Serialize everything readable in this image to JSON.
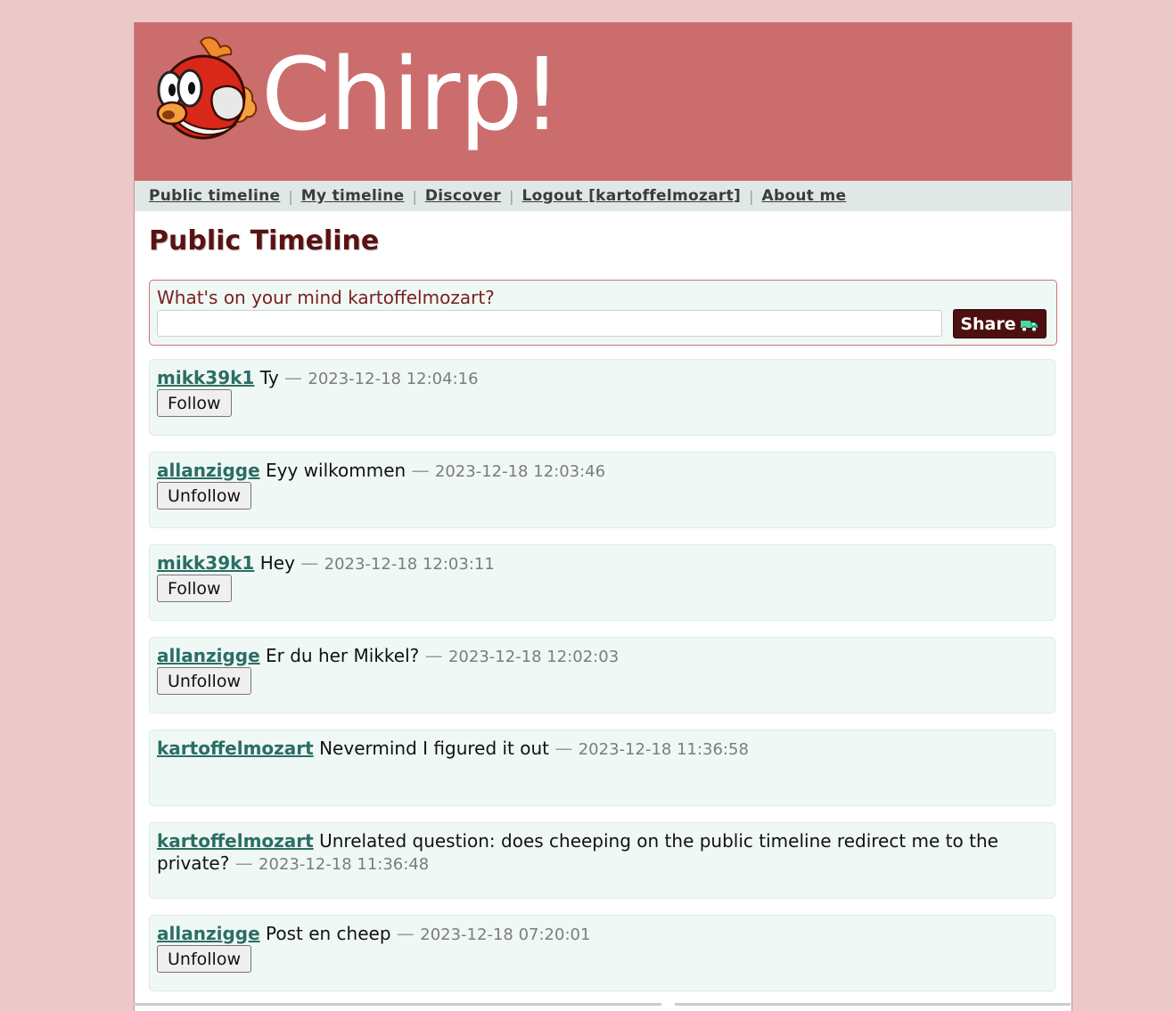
{
  "header": {
    "brand": "Chirp!"
  },
  "nav": {
    "public_timeline": "Public timeline",
    "my_timeline": "My timeline",
    "discover": "Discover",
    "logout": "Logout [kartoffelmozart]",
    "about_me": "About me",
    "separator": "|"
  },
  "page_title": "Public Timeline",
  "composer": {
    "label": "What's on your mind kartoffelmozart?",
    "value": "",
    "share_label": "Share"
  },
  "cheeps": [
    {
      "author": "mikk39k1",
      "text": "Ty",
      "dash": "—",
      "timestamp": "2023-12-18 12:04:16",
      "button": "Follow"
    },
    {
      "author": "allanzigge",
      "text": "Eyy wilkommen",
      "dash": "—",
      "timestamp": "2023-12-18 12:03:46",
      "button": "Unfollow"
    },
    {
      "author": "mikk39k1",
      "text": "Hey",
      "dash": "—",
      "timestamp": "2023-12-18 12:03:11",
      "button": "Follow"
    },
    {
      "author": "allanzigge",
      "text": "Er du her Mikkel?",
      "dash": "—",
      "timestamp": "2023-12-18 12:02:03",
      "button": "Unfollow"
    },
    {
      "author": "kartoffelmozart",
      "text": "Nevermind I figured it out",
      "dash": "—",
      "timestamp": "2023-12-18 11:36:58",
      "button": ""
    },
    {
      "author": "kartoffelmozart",
      "text": "Unrelated question: does cheeping on the public timeline redirect me to the private?",
      "dash": "—",
      "timestamp": "2023-12-18 11:36:48",
      "button": ""
    },
    {
      "author": "allanzigge",
      "text": "Post en cheep",
      "dash": "—",
      "timestamp": "2023-12-18 07:20:01",
      "button": "Unfollow"
    }
  ],
  "colors": {
    "background": "#ecc8c8",
    "header": "#cb6d6d",
    "title": "#5a1212",
    "author_link": "#2a6e64",
    "share_button": "#4d0f0f",
    "cheep_bg": "#f0f8f6"
  },
  "icons": {
    "logo": "cheep-cheep-fish-logo",
    "share": "green-truck-icon"
  }
}
